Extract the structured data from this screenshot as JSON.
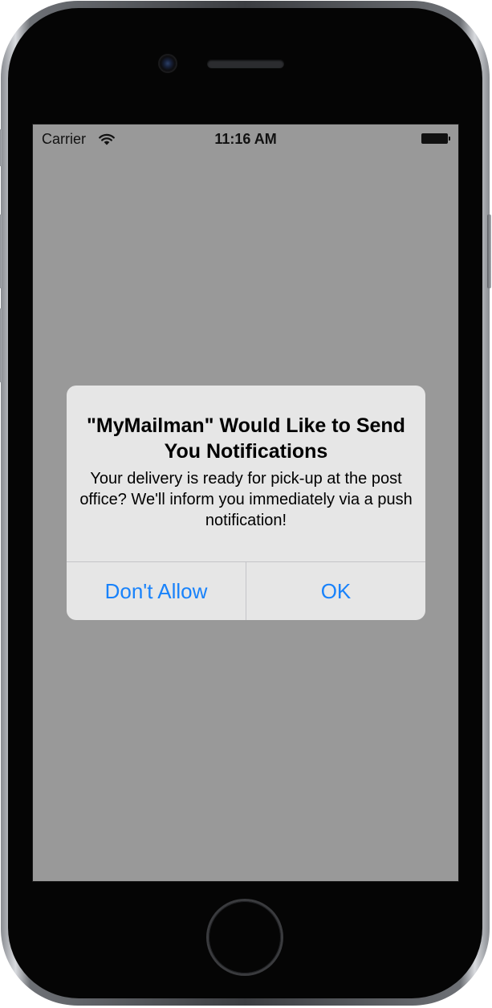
{
  "status_bar": {
    "carrier": "Carrier",
    "time": "11:16 AM",
    "wifi_icon": "wifi-icon",
    "battery_icon": "battery-full-icon"
  },
  "alert": {
    "title": "\"MyMailman\" Would Like to Send You Notifications",
    "message": "Your delivery is ready for pick-up at the post office? We'll inform you immediately via a push notification!",
    "buttons": [
      {
        "label": "Don't Allow"
      },
      {
        "label": "OK"
      }
    ],
    "button_color": "#1882fb",
    "background_color": "#e6e6e6"
  },
  "screen": {
    "background_color": "#999999"
  },
  "device": {
    "home_button_icon": "home-button"
  }
}
